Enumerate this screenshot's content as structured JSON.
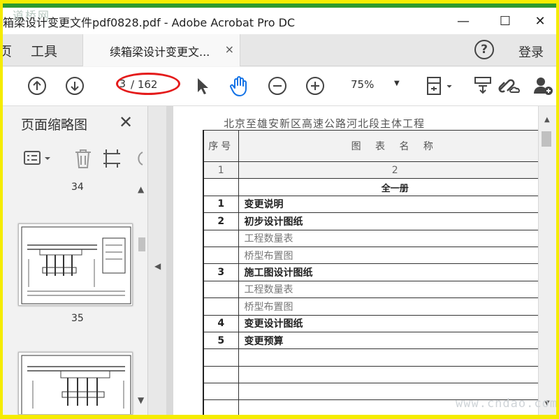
{
  "window": {
    "title": "箱梁设计变更文件pdf0828.pdf - Adobe Acrobat Pro DC",
    "watermark": "道桥网",
    "minimize_label": "—",
    "maximize_label": "☐",
    "close_label": "✕"
  },
  "tabs": {
    "partial_label": "页",
    "tools_label": "工具",
    "document_tab_label": "续箱梁设计变更文...",
    "document_tab_close": "×",
    "help_label": "?",
    "login_label": "登录"
  },
  "toolbar": {
    "current_page": "3",
    "total_pages": "/ 162",
    "zoom_level": "75%"
  },
  "sidebar": {
    "title": "页面缩略图",
    "close_label": "✕",
    "thumbnails": [
      {
        "page_label": "34"
      },
      {
        "page_label": "35"
      }
    ]
  },
  "document": {
    "header": "北京至雄安新区高速公路河北段主体工程",
    "columns": [
      "序号",
      "图 表 名 称"
    ],
    "index_row": [
      "1",
      "2"
    ],
    "volume_title": "全一册",
    "rows": [
      {
        "no": "1",
        "name": "变更说明",
        "style": "bold"
      },
      {
        "no": "2",
        "name": "初步设计图纸",
        "style": "bold"
      },
      {
        "no": "",
        "name": "工程数量表",
        "style": "sub"
      },
      {
        "no": "",
        "name": "桥型布置图",
        "style": "sub"
      },
      {
        "no": "3",
        "name": "施工图设计图纸",
        "style": "bold"
      },
      {
        "no": "",
        "name": "工程数量表",
        "style": "sub"
      },
      {
        "no": "",
        "name": "桥型布置图",
        "style": "sub"
      },
      {
        "no": "4",
        "name": "变更设计图纸",
        "style": "bold"
      },
      {
        "no": "5",
        "name": "变更预算",
        "style": "bold"
      },
      {
        "no": "",
        "name": "",
        "style": "sub"
      },
      {
        "no": "",
        "name": "",
        "style": "sub"
      },
      {
        "no": "",
        "name": "",
        "style": "sub"
      },
      {
        "no": "",
        "name": "",
        "style": "sub"
      }
    ]
  },
  "site_watermark": "www.cndao.com",
  "colors": {
    "annotation_red": "#e41b1b",
    "frame_yellow": "#f5ec00",
    "frame_green": "#2e9a2e",
    "hand_tool_blue": "#1473e6"
  },
  "icons": [
    "prev-page-icon",
    "next-page-icon",
    "select-arrow-icon",
    "hand-tool-icon",
    "zoom-out-icon",
    "zoom-in-icon",
    "page-fit-icon",
    "scroll-mode-icon",
    "link-cloud-icon",
    "add-user-icon",
    "options-menu-icon",
    "delete-icon",
    "crop-icon",
    "rotate-icon"
  ]
}
